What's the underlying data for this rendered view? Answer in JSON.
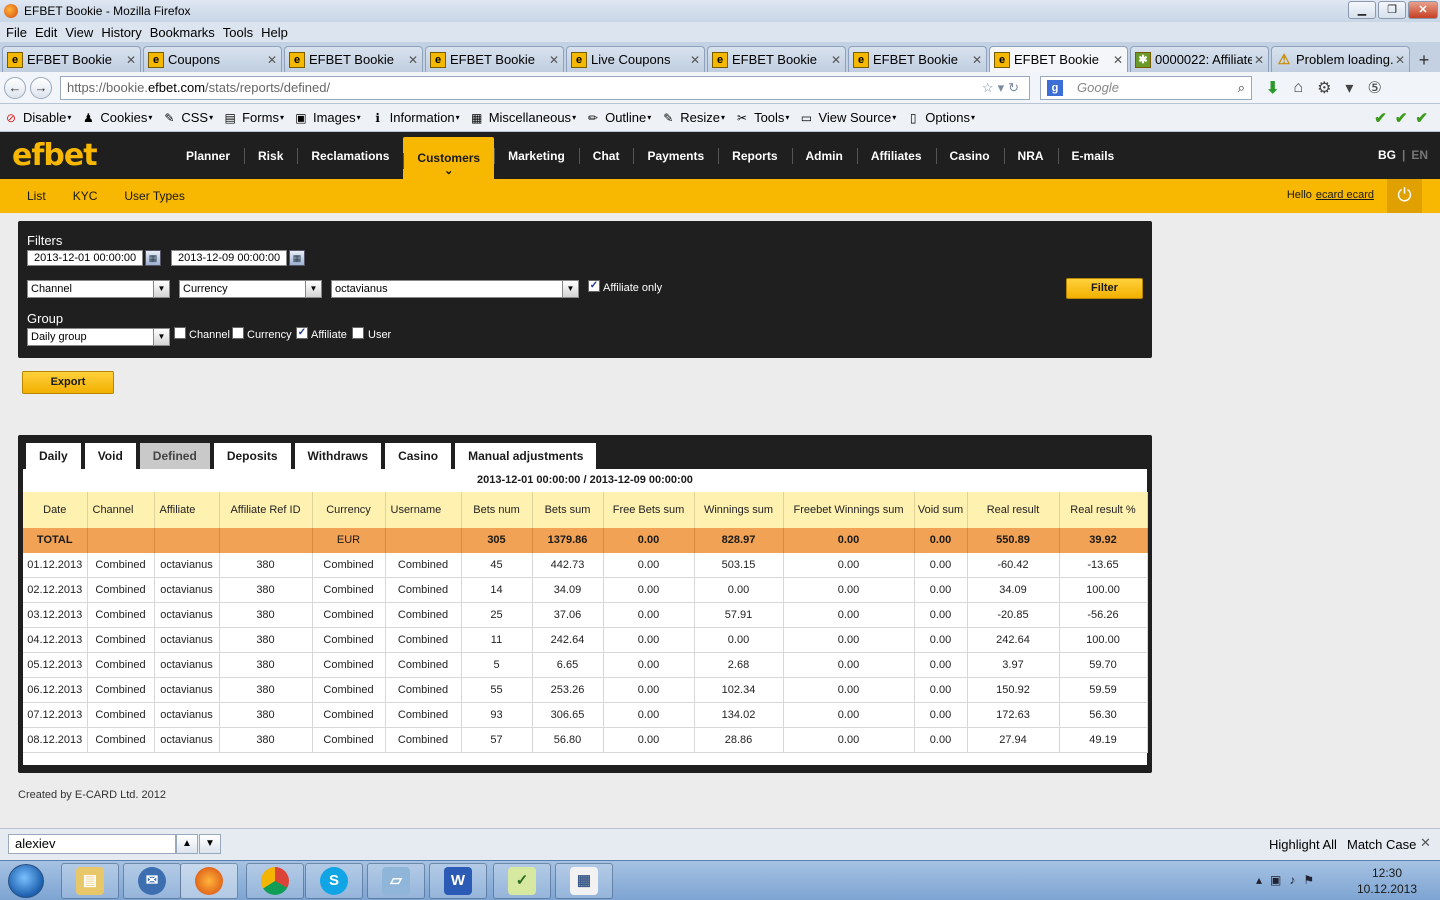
{
  "window": {
    "title": "EFBET Bookie - Mozilla Firefox"
  },
  "menu": [
    "File",
    "Edit",
    "View",
    "History",
    "Bookmarks",
    "Tools",
    "Help"
  ],
  "browser_tabs": [
    {
      "label": "EFBET Bookie",
      "icon": "efbet-icon"
    },
    {
      "label": "Coupons",
      "icon": "efbet-icon"
    },
    {
      "label": "EFBET Bookie",
      "icon": "efbet-icon"
    },
    {
      "label": "EFBET Bookie",
      "icon": "efbet-icon"
    },
    {
      "label": "Live Coupons",
      "icon": "efbet-icon"
    },
    {
      "label": "EFBET Bookie",
      "icon": "efbet-icon"
    },
    {
      "label": "EFBET Bookie",
      "icon": "efbet-icon"
    },
    {
      "label": "EFBET Bookie",
      "icon": "efbet-icon",
      "active": true
    },
    {
      "label": "0000022: Affiliate...",
      "icon": "bug-icon"
    },
    {
      "label": "Problem loading...",
      "icon": "warning-icon"
    }
  ],
  "url": {
    "prefix": "https://bookie.",
    "host": "efbet.com",
    "path": "/stats/reports/defined/"
  },
  "search": {
    "placeholder": "Google",
    "engine_letter": "g"
  },
  "devtoolbar": [
    {
      "label": "Disable",
      "icon": "⊘"
    },
    {
      "label": "Cookies",
      "icon": "♟"
    },
    {
      "label": "CSS",
      "icon": "✎"
    },
    {
      "label": "Forms",
      "icon": "▤"
    },
    {
      "label": "Images",
      "icon": "▣"
    },
    {
      "label": "Information",
      "icon": "ℹ"
    },
    {
      "label": "Miscellaneous",
      "icon": "▦"
    },
    {
      "label": "Outline",
      "icon": "✏"
    },
    {
      "label": "Resize",
      "icon": "✎"
    },
    {
      "label": "Tools",
      "icon": "✂"
    },
    {
      "label": "View Source",
      "icon": "▭"
    },
    {
      "label": "Options",
      "icon": "▯"
    }
  ],
  "site": {
    "logo": "efbet",
    "nav": [
      "Planner",
      "Risk",
      "Reclamations",
      "Customers",
      "Marketing",
      "Chat",
      "Payments",
      "Reports",
      "Admin",
      "Affiliates",
      "Casino",
      "NRA",
      "E-mails"
    ],
    "active_nav": "Customers",
    "lang_active": "BG",
    "lang_inactive": "EN",
    "subnav": [
      "List",
      "KYC",
      "User Types"
    ],
    "hello": "Hello",
    "username": "ecard ecard"
  },
  "filters": {
    "title": "Filters",
    "date_from": "2013-12-01 00:00:00",
    "date_to": "2013-12-09 00:00:00",
    "channel": "Channel",
    "currency": "Currency",
    "affiliate": "octavianus",
    "affiliate_only_label": "Affiliate only",
    "affiliate_only_checked": true,
    "filter_button": "Filter",
    "group_title": "Group",
    "group_select": "Daily group",
    "group_checks": [
      {
        "label": "Channel",
        "checked": false
      },
      {
        "label": "Currency",
        "checked": false
      },
      {
        "label": "Affiliate",
        "checked": true
      },
      {
        "label": "User",
        "checked": false
      }
    ],
    "export_button": "Export"
  },
  "report": {
    "tabs": [
      "Daily",
      "Void",
      "Defined",
      "Deposits",
      "Withdraws",
      "Casino",
      "Manual adjustments"
    ],
    "active_tab": "Defined",
    "period": "2013-12-01 00:00:00 / 2013-12-09 00:00:00",
    "columns": [
      "Date",
      "Channel",
      "Affiliate",
      "Affiliate Ref ID",
      "Currency",
      "Username",
      "Bets num",
      "Bets sum",
      "Free Bets sum",
      "Winnings sum",
      "Freebet Winnings sum",
      "Void sum",
      "Real result",
      "Real result %"
    ],
    "total": [
      "TOTAL",
      "",
      "",
      "",
      "EUR",
      "",
      "305",
      "1379.86",
      "0.00",
      "828.97",
      "0.00",
      "0.00",
      "550.89",
      "39.92"
    ],
    "rows": [
      [
        "01.12.2013",
        "Combined",
        "octavianus",
        "380",
        "Combined",
        "Combined",
        "45",
        "442.73",
        "0.00",
        "503.15",
        "0.00",
        "0.00",
        "-60.42",
        "-13.65"
      ],
      [
        "02.12.2013",
        "Combined",
        "octavianus",
        "380",
        "Combined",
        "Combined",
        "14",
        "34.09",
        "0.00",
        "0.00",
        "0.00",
        "0.00",
        "34.09",
        "100.00"
      ],
      [
        "03.12.2013",
        "Combined",
        "octavianus",
        "380",
        "Combined",
        "Combined",
        "25",
        "37.06",
        "0.00",
        "57.91",
        "0.00",
        "0.00",
        "-20.85",
        "-56.26"
      ],
      [
        "04.12.2013",
        "Combined",
        "octavianus",
        "380",
        "Combined",
        "Combined",
        "11",
        "242.64",
        "0.00",
        "0.00",
        "0.00",
        "0.00",
        "242.64",
        "100.00"
      ],
      [
        "05.12.2013",
        "Combined",
        "octavianus",
        "380",
        "Combined",
        "Combined",
        "5",
        "6.65",
        "0.00",
        "2.68",
        "0.00",
        "0.00",
        "3.97",
        "59.70"
      ],
      [
        "06.12.2013",
        "Combined",
        "octavianus",
        "380",
        "Combined",
        "Combined",
        "55",
        "253.26",
        "0.00",
        "102.34",
        "0.00",
        "0.00",
        "150.92",
        "59.59"
      ],
      [
        "07.12.2013",
        "Combined",
        "octavianus",
        "380",
        "Combined",
        "Combined",
        "93",
        "306.65",
        "0.00",
        "134.02",
        "0.00",
        "0.00",
        "172.63",
        "56.30"
      ],
      [
        "08.12.2013",
        "Combined",
        "octavianus",
        "380",
        "Combined",
        "Combined",
        "57",
        "56.80",
        "0.00",
        "28.86",
        "0.00",
        "0.00",
        "27.94",
        "49.19"
      ]
    ]
  },
  "footer": "Created by E-CARD Ltd. 2012",
  "findbar": {
    "value": "alexiev",
    "highlight_all": "Highlight All",
    "match_case": "Match Case"
  },
  "taskbar": {
    "apps": [
      "explorer",
      "thunderbird",
      "firefox",
      "chrome",
      "skype",
      "notepad",
      "word",
      "excel-checklist",
      "spreadsheet"
    ],
    "time": "12:30",
    "date": "10.12.2013 г."
  }
}
